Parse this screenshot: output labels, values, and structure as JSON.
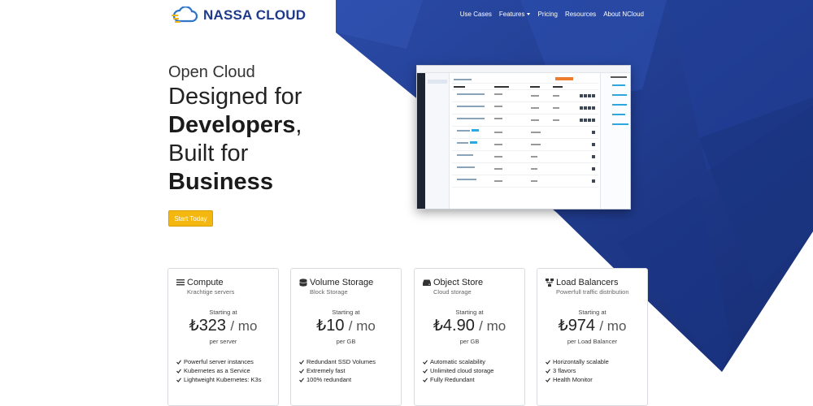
{
  "brand": {
    "name": "NASSA CLOUD",
    "color_primary": "#1f3a8a",
    "color_accent": "#f3b70f",
    "color_bg_dark": "#1e3a8a"
  },
  "nav": [
    {
      "label": "Use Cases"
    },
    {
      "label": "Features",
      "has_dropdown": true
    },
    {
      "label": "Pricing"
    },
    {
      "label": "Resources"
    },
    {
      "label": "About NCloud"
    }
  ],
  "hero": {
    "line1": "Open Cloud",
    "line2": "Designed for",
    "line3_bold": "Developers",
    "line3_rest": ",",
    "line4": "Built for",
    "line5_bold": "Business",
    "cta": "Start Today"
  },
  "cards": [
    {
      "icon": "server-list-icon",
      "title": "Compute",
      "subtitle": "Krachtige servers",
      "starting": "Starting at",
      "currency": "₺",
      "price": "323",
      "period": "/ mo",
      "unit": "per server",
      "features": [
        "Powerful server instances",
        "Kubernetes as a Service",
        "Lightweight Kubernetes: K3s"
      ]
    },
    {
      "icon": "database-icon",
      "title": "Volume Storage",
      "subtitle": "Block Storage",
      "starting": "Starting at",
      "currency": "₺",
      "price": "10",
      "period": "/ mo",
      "unit": "per GB",
      "features": [
        "Redundant SSD Volumes",
        "Extremely fast",
        "100% redundant"
      ]
    },
    {
      "icon": "hard-drive-icon",
      "title": "Object Store",
      "subtitle": "Cloud storage",
      "starting": "Starting at",
      "currency": "₺",
      "price": "4.90",
      "period": "/ mo",
      "unit": "per GB",
      "features": [
        "Automatic scalability",
        "Unlimited cloud storage",
        "Fully Redundant"
      ]
    },
    {
      "icon": "network-icon",
      "title": "Load Balancers",
      "subtitle": "Powerfull traffic distribution",
      "starting": "Starting at",
      "currency": "₺",
      "price": "974",
      "period": "/ mo",
      "unit": "per Load Balancer",
      "features": [
        "Horizontally scalable",
        "3 flavors",
        "Health Monitor"
      ]
    }
  ]
}
